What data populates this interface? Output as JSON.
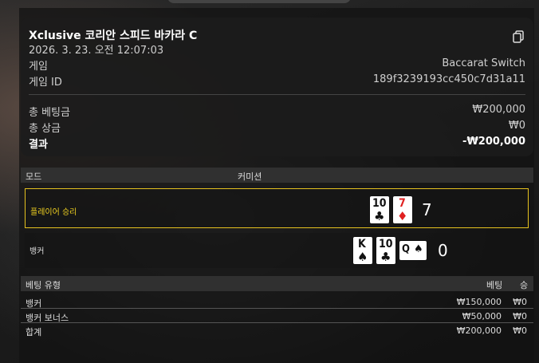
{
  "header": {
    "title": "Xclusive 코리안 스피드 바카라 C",
    "datetime": "2026. 3. 23. 오전 12:07:03"
  },
  "info": [
    {
      "label": "게임",
      "value": "Baccarat Switch"
    },
    {
      "label": "게임 ID",
      "value": "189f3239193cc450c7d31a11"
    }
  ],
  "totals": [
    {
      "label": "총 베팅금",
      "value": "₩200,000"
    },
    {
      "label": "총 상금",
      "value": "₩0"
    },
    {
      "label": "결과",
      "value": "-₩200,000"
    }
  ],
  "mode_header": {
    "mode": "모드",
    "commission": "커미션"
  },
  "player": {
    "label": "플레이어 승리",
    "score": "7",
    "cards": [
      {
        "rank": "10",
        "suit": "♣",
        "color": "black"
      },
      {
        "rank": "7",
        "suit": "♦",
        "color": "red"
      }
    ]
  },
  "banker": {
    "label": "뱅커",
    "score": "0",
    "cards": [
      {
        "rank": "K",
        "suit": "♠",
        "color": "black"
      },
      {
        "rank": "10",
        "suit": "♣",
        "color": "black"
      },
      {
        "rank": "Q",
        "suit": "♠",
        "color": "black"
      }
    ]
  },
  "bets_header": {
    "type": "베팅 유형",
    "bet": "베팅",
    "win": "승"
  },
  "bets": [
    {
      "type": "뱅커",
      "bet": "₩150,000",
      "win": "₩0"
    },
    {
      "type": "뱅커 보너스",
      "bet": "₩50,000",
      "win": "₩0"
    },
    {
      "type": "합계",
      "bet": "₩200,000",
      "win": "₩0"
    }
  ],
  "colors": {
    "accent": "#e6c21f",
    "player_label": "#f0d020"
  }
}
